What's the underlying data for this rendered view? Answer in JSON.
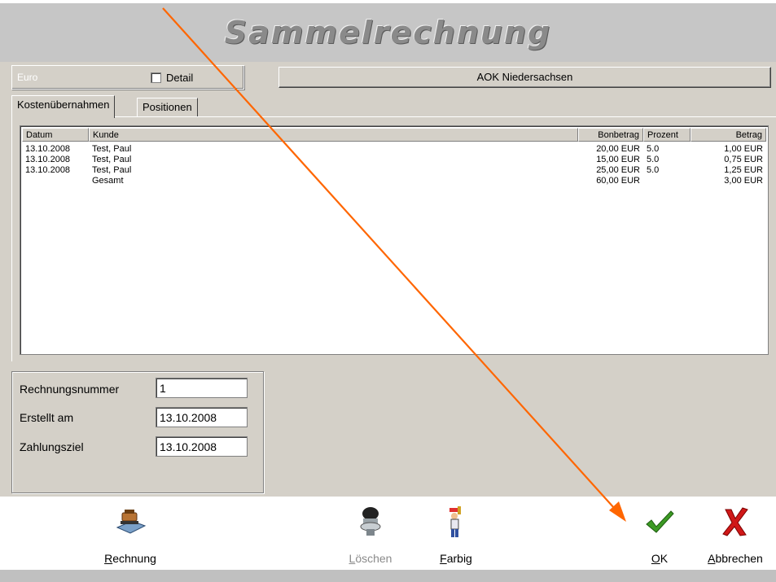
{
  "window": {
    "title": "Sammelrechnung"
  },
  "currency": {
    "label": "Euro",
    "detail_label": "Detail",
    "detail_checked": false
  },
  "customer": {
    "name": "AOK Niedersachsen"
  },
  "tabs": [
    {
      "label": "Kostenübernahmen",
      "active": true
    },
    {
      "label": "Positionen",
      "active": false
    }
  ],
  "table": {
    "columns": [
      "Datum",
      "Kunde",
      "Bonbetrag",
      "Prozent",
      "Betrag"
    ],
    "rows": [
      {
        "datum": "13.10.2008",
        "kunde": "Test, Paul",
        "bonbetrag": "20,00 EUR",
        "prozent": "5.0",
        "betrag": "1,00 EUR"
      },
      {
        "datum": "13.10.2008",
        "kunde": "Test, Paul",
        "bonbetrag": "15,00 EUR",
        "prozent": "5.0",
        "betrag": "0,75 EUR"
      },
      {
        "datum": "13.10.2008",
        "kunde": "Test, Paul",
        "bonbetrag": "25,00 EUR",
        "prozent": "5.0",
        "betrag": "1,25 EUR"
      }
    ],
    "total": {
      "label": "Gesamt",
      "bonbetrag": "60,00 EUR",
      "betrag": "3,00 EUR"
    }
  },
  "fields": {
    "rechnungsnummer": {
      "label": "Rechnungsnummer",
      "value": "1"
    },
    "erstellt": {
      "label": "Erstellt am",
      "value": "13.10.2008"
    },
    "zahlungsziel": {
      "label": "Zahlungsziel",
      "value": "13.10.2008"
    }
  },
  "toolbar": {
    "rechnung": {
      "key": "R",
      "rest": "echnung",
      "icon": "invoice-stamp-icon"
    },
    "loeschen": {
      "key": "L",
      "rest": "öschen",
      "icon": "toilet-icon",
      "disabled": true
    },
    "farbig": {
      "key": "F",
      "rest": "arbig",
      "icon": "painter-icon"
    },
    "ok": {
      "key": "O",
      "rest": "K",
      "icon": "checkmark-icon"
    },
    "abbrechen": {
      "key": "A",
      "rest": "bbrechen",
      "icon": "red-x-icon"
    }
  },
  "colors": {
    "annotation_arrow": "#ff6600",
    "ok_green": "#2e8b1e",
    "cancel_red": "#d01010"
  }
}
